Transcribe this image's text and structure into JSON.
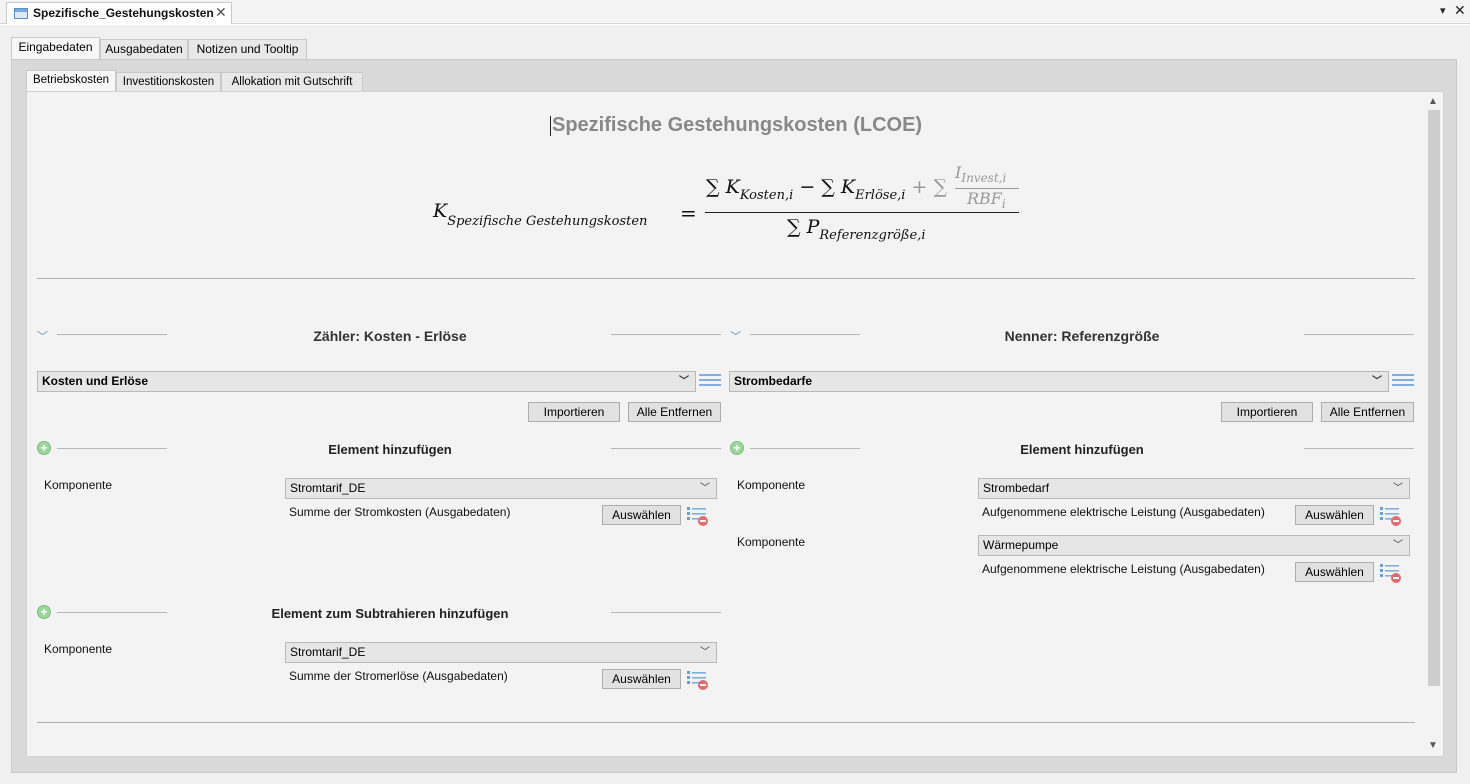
{
  "window": {
    "tab_title": "Spezifische_Gestehungskosten",
    "close_glyph": "✕",
    "menu_glyph": "▾"
  },
  "outer_tabs": [
    "Eingabedaten",
    "Ausgabedaten",
    "Notizen und Tooltip"
  ],
  "inner_tabs": [
    "Betriebskosten",
    "Investitionskosten",
    "Allokation mit Gutschrift"
  ],
  "main_title": "Spezifische Gestehungskosten (LCOE)",
  "formula": {
    "lhs_base": "K",
    "lhs_sub": "Spezifische Gestehungskosten",
    "equals": "=",
    "num_term1_base": "∑ K",
    "num_term1_sub": "Kosten,i",
    "num_minus": "−",
    "num_term2_base": "∑ K",
    "num_term2_sub": "Erlöse,i",
    "num_plus": "+ ∑",
    "frac_num_base": "I",
    "frac_num_sub": "Invest,i",
    "frac_den_base": "RBF",
    "frac_den_sub": "i",
    "den_base": "∑ P",
    "den_sub": "Referenzgröße,i"
  },
  "left": {
    "section_title": "Zähler: Kosten - Erlöse",
    "list_select": "Kosten und Erlöse",
    "import_label": "Importieren",
    "remove_all_label": "Alle Entfernen",
    "add_title": "Element hinzufügen",
    "add_items": [
      {
        "label": "Komponente",
        "value": "Stromtarif_DE",
        "description": "Summe der Stromkosten  (Ausgabedaten)",
        "select_label": "Auswählen"
      }
    ],
    "subtract_title": "Element zum Subtrahieren hinzufügen",
    "subtract_items": [
      {
        "label": "Komponente",
        "value": "Stromtarif_DE",
        "description": "Summe der Stromerlöse (Ausgabedaten)",
        "select_label": "Auswählen"
      }
    ]
  },
  "right": {
    "section_title": "Nenner: Referenzgröße",
    "list_select": "Strombedarfe",
    "import_label": "Importieren",
    "remove_all_label": "Alle Entfernen",
    "add_title": "Element hinzufügen",
    "add_items": [
      {
        "label": "Komponente",
        "value": "Strombedarf",
        "description": "Aufgenommene elektrische Leistung (Ausgabedaten)",
        "select_label": "Auswählen"
      },
      {
        "label": "Komponente",
        "value": "Wärmepumpe",
        "description": "Aufgenommene elektrische Leistung (Ausgabedaten)",
        "select_label": "Auswählen"
      }
    ]
  },
  "icons": {
    "chevron": "chevron-down-icon",
    "add": "add-circle-icon",
    "list": "list-icon",
    "remove": "pin-remove-icon"
  }
}
